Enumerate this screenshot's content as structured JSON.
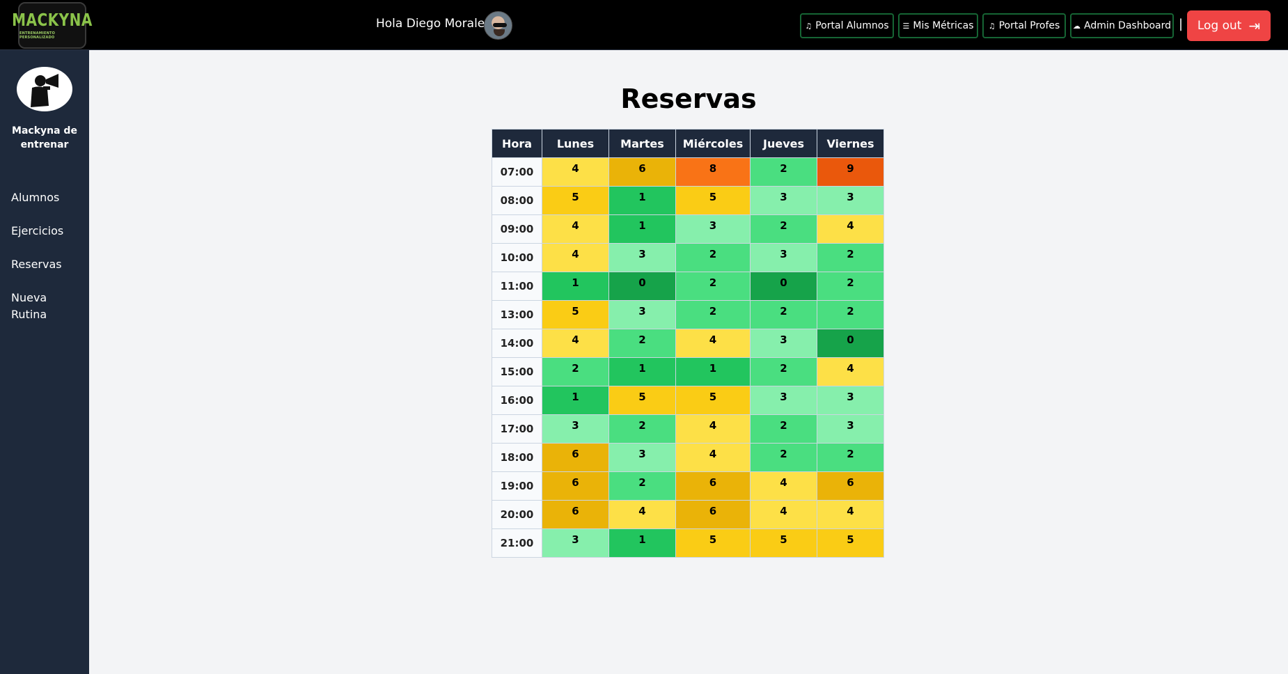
{
  "header": {
    "logo_text": "MACKYNA",
    "logo_tagline": "ENTRENAMIENTO PERSONALIZADO",
    "greeting": "Hola Diego Morales!",
    "nav": [
      {
        "label": "Portal Alumnos",
        "icon": "music-note-icon"
      },
      {
        "label": "Mis Métricas",
        "icon": "list-icon"
      },
      {
        "label": "Portal Profes",
        "icon": "music-note-icon"
      },
      {
        "label": "Admin Dashboard",
        "icon": "cloud-icon"
      }
    ],
    "separator": "|",
    "logout_label": "Log out"
  },
  "sidebar": {
    "name": "Mackyna de entrenar",
    "items": [
      {
        "label": "Alumnos"
      },
      {
        "label": "Ejercicios"
      },
      {
        "label": "Reservas"
      },
      {
        "label": "Nueva Rutina"
      }
    ]
  },
  "main": {
    "title": "Reservas",
    "columns": [
      "Hora",
      "Lunes",
      "Martes",
      "Miércoles",
      "Jueves",
      "Viernes"
    ],
    "rows": [
      {
        "hora": "07:00",
        "values": [
          4,
          6,
          8,
          2,
          9
        ]
      },
      {
        "hora": "08:00",
        "values": [
          5,
          1,
          5,
          3,
          3
        ]
      },
      {
        "hora": "09:00",
        "values": [
          4,
          1,
          3,
          2,
          4
        ]
      },
      {
        "hora": "10:00",
        "values": [
          4,
          3,
          2,
          3,
          2
        ]
      },
      {
        "hora": "11:00",
        "values": [
          1,
          0,
          2,
          0,
          2
        ]
      },
      {
        "hora": "13:00",
        "values": [
          5,
          3,
          2,
          2,
          2
        ]
      },
      {
        "hora": "14:00",
        "values": [
          4,
          2,
          4,
          3,
          0
        ]
      },
      {
        "hora": "15:00",
        "values": [
          2,
          1,
          1,
          2,
          4
        ]
      },
      {
        "hora": "16:00",
        "values": [
          1,
          5,
          5,
          3,
          3
        ]
      },
      {
        "hora": "17:00",
        "values": [
          3,
          2,
          4,
          2,
          3
        ]
      },
      {
        "hora": "18:00",
        "values": [
          6,
          3,
          4,
          2,
          2
        ]
      },
      {
        "hora": "19:00",
        "values": [
          6,
          2,
          6,
          4,
          6
        ]
      },
      {
        "hora": "20:00",
        "values": [
          6,
          4,
          6,
          4,
          4
        ]
      },
      {
        "hora": "21:00",
        "values": [
          3,
          1,
          5,
          5,
          5
        ]
      }
    ]
  },
  "colors": {
    "scale": {
      "0": "#16a34a",
      "1": "#22c55e",
      "2": "#4ade80",
      "3": "#86efac",
      "4": "#fde047",
      "5": "#facc15",
      "6": "#eab308",
      "8": "#f97316",
      "9": "#ea580c"
    },
    "logout": "#ef4444",
    "nav_border": "#166534",
    "sidebar": "#1e293b"
  }
}
